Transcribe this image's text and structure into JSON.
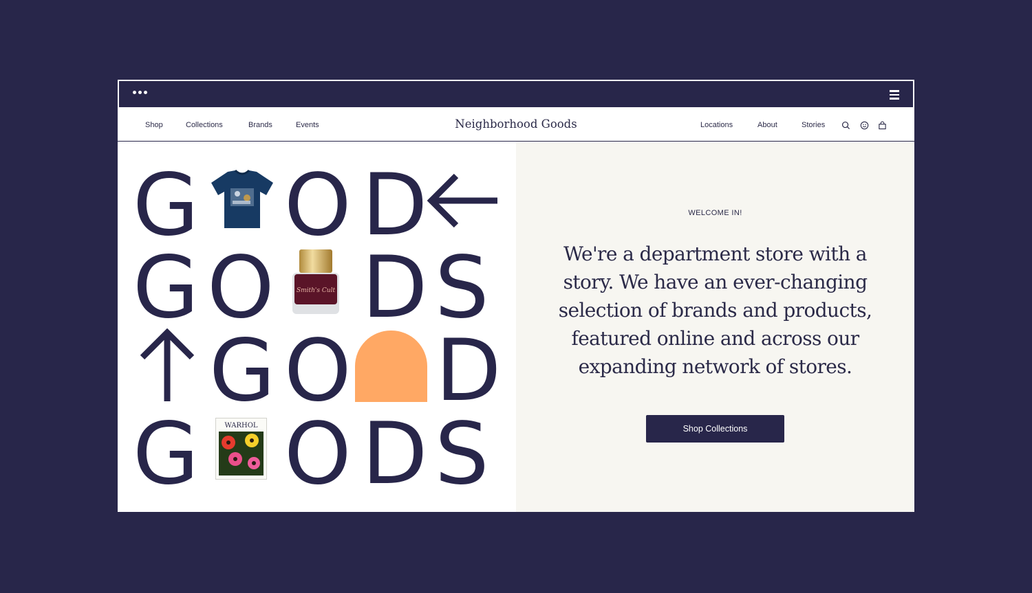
{
  "window": {
    "menu_icon": "dots-icon",
    "hamburger_icon": "hamburger-icon"
  },
  "nav": {
    "left_links": [
      "Shop",
      "Collections",
      "Brands",
      "Events"
    ],
    "brand": "Neighborhood Goods",
    "right_links": [
      "Locations",
      "About",
      "Stories"
    ],
    "icons": [
      "search-icon",
      "account-icon",
      "cart-icon"
    ]
  },
  "hero_art": {
    "rows": [
      [
        "G",
        "t-shirt-image",
        "O",
        "D",
        "left-arrow-icon"
      ],
      [
        "G",
        "O",
        "nail-polish-image",
        "D",
        "S"
      ],
      [
        "up-arrow-icon",
        "G",
        "O",
        "orange-arch-shape",
        "D"
      ],
      [
        "G",
        "warhol-book-image",
        "O",
        "D",
        "S"
      ]
    ],
    "book_title": "WARHOL",
    "bottle_text": "Smith's Cult",
    "colors": {
      "ink": "#28264a",
      "orange": "#ffa864"
    }
  },
  "intro": {
    "kicker": "WELCOME IN!",
    "text": "We're a department store with a story. We have an ever-changing selection of brands and products, featured online and across our expanding network of stores.",
    "button": "Shop Collections"
  },
  "colors": {
    "background": "#28264a",
    "panel": "#f7f6f1",
    "accent": "#ffa864"
  }
}
